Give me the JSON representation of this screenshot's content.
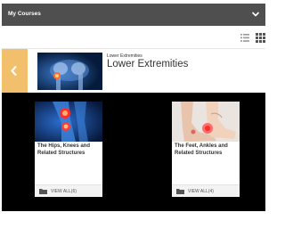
{
  "topbar": {
    "title": "My Courses"
  },
  "header": {
    "breadcrumb": "Lower Extremities",
    "title": "Lower Extremities"
  },
  "cards": [
    {
      "title": "The Hips, Knees and Related Structures",
      "view_all": "VIEW ALL(6)"
    },
    {
      "title": "The Feet, Ankles and Related Structures",
      "view_all": "VIEW ALL(4)"
    }
  ],
  "icons": {
    "topbar_toggle": "chevron-down-icon",
    "list_view": "list-view-icon",
    "grid_view": "grid-view-icon",
    "back": "chevron-left-icon",
    "folder": "folder-icon"
  },
  "colors": {
    "topbar": "#4f4f4f",
    "back_button": "#f2c06d",
    "content_bg": "#000000"
  }
}
